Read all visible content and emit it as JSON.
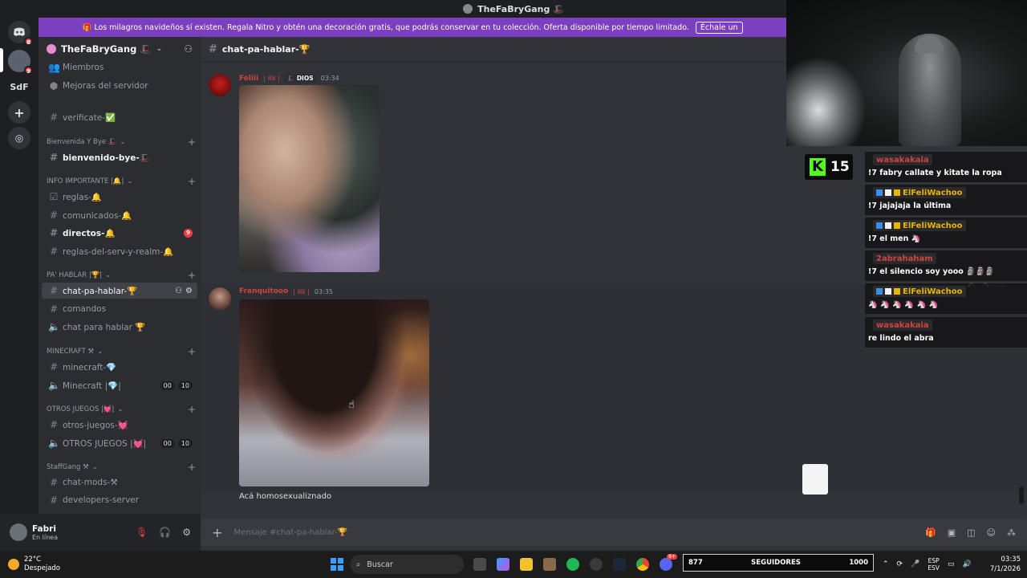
{
  "window": {
    "title": "TheFaBryGang 🎩"
  },
  "rail": {
    "sdf_label": "SdF",
    "server_badge": "9",
    "dm_badge": "8"
  },
  "banner": {
    "text": "🎁 Los milagros navideños sí existen. Regala Nitro y obtén una decoración gratis, que podrás conservar en tu colección. Oferta disponible por tiempo limitado.",
    "button": "Échale un"
  },
  "server": {
    "name": "TheFaBryGang 🎩"
  },
  "sidebar": {
    "top_items": [
      {
        "label": "Miembros"
      },
      {
        "label": "Mejoras del servidor"
      }
    ],
    "verificate": "verificate-✅",
    "categories": [
      {
        "label": "Bienvenida Y Bye 🎩"
      },
      {
        "label": "INFO IMPORTANTE |🔔|"
      },
      {
        "label": "PA' HABLAR |🏆|"
      },
      {
        "label": "MINECRAFT ⚒"
      },
      {
        "label": "OTROS JUEGOS |💓|"
      },
      {
        "label": "StaffGang ⚒"
      }
    ],
    "channels": {
      "bienvenido": "bienvenido-bye-🎩",
      "reglas": "reglas-🔔",
      "comunicados": "comunicados-🔔",
      "directos": "directos-🔔",
      "directos_badge": "9",
      "reglas_serv": "reglas-del-serv-y-realm-🔔",
      "chat_pa_hablar": "chat-pa-hablar-🏆",
      "comandos": "comandos",
      "chat_para_hablar": "chat para hablar 🏆",
      "minecraft_text": "minecraft-💎",
      "minecraft_voice": "Minecraft |💎|",
      "minecraft_counts": [
        "00",
        "10"
      ],
      "otros_text": "otros-juegos-💓",
      "otros_voice": "OTROS JUEGOS |💓|",
      "otros_counts": [
        "00",
        "10"
      ],
      "chat_mods": "chat-mods-⚒",
      "developers": "developers-server"
    }
  },
  "user": {
    "name": "Fabri",
    "status": "En línea"
  },
  "chat": {
    "channel": "chat-pa-hablar-🏆",
    "messages": [
      {
        "author": "Feliii",
        "tag": "| 🎟 |",
        "role": "🎩 DIOS",
        "time": "03:34"
      },
      {
        "author": "Franquitooo",
        "tag": "| 🎟 |",
        "time": "03:35",
        "text": "Acá homosexualiznado"
      }
    ],
    "composer_placeholder": "Mensaje #chat-pa-hablar-🏆"
  },
  "stream": {
    "kick_count": "15",
    "chat": [
      {
        "user": "wasakakaia",
        "color": "#d0443f",
        "badges": false,
        "text": "!7 fabry callate y kitate la ropa"
      },
      {
        "user": "ElFeliWachoo",
        "color": "#e9b400",
        "badges": true,
        "text": "!7 jajajaja la última"
      },
      {
        "user": "ElFeliWachoo",
        "color": "#e9b400",
        "badges": true,
        "text": "!7 el men 🦄"
      },
      {
        "user": "2abrahaham",
        "color": "#d0443f",
        "badges": false,
        "text": "!7 el silencio soy yooo 🗿🗿🗿"
      },
      {
        "user": "ElFeliWachoo",
        "color": "#e9b400",
        "badges": true,
        "text": "🦄 🦄 🦄 🦄 🦄 🦄"
      },
      {
        "user": "wasakakaia",
        "color": "#d0443f",
        "badges": false,
        "text": "re lindo el abra"
      }
    ],
    "followers": {
      "current": "877",
      "label": "SEGUIDORES",
      "goal": "1000"
    }
  },
  "taskbar": {
    "weather_temp": "22°C",
    "weather_desc": "Despejado",
    "search": "Buscar",
    "lang_top": "ESP",
    "lang_bottom": "ESV",
    "time": "03:35",
    "date": "7/1/2026",
    "discord_badge": "9+"
  }
}
